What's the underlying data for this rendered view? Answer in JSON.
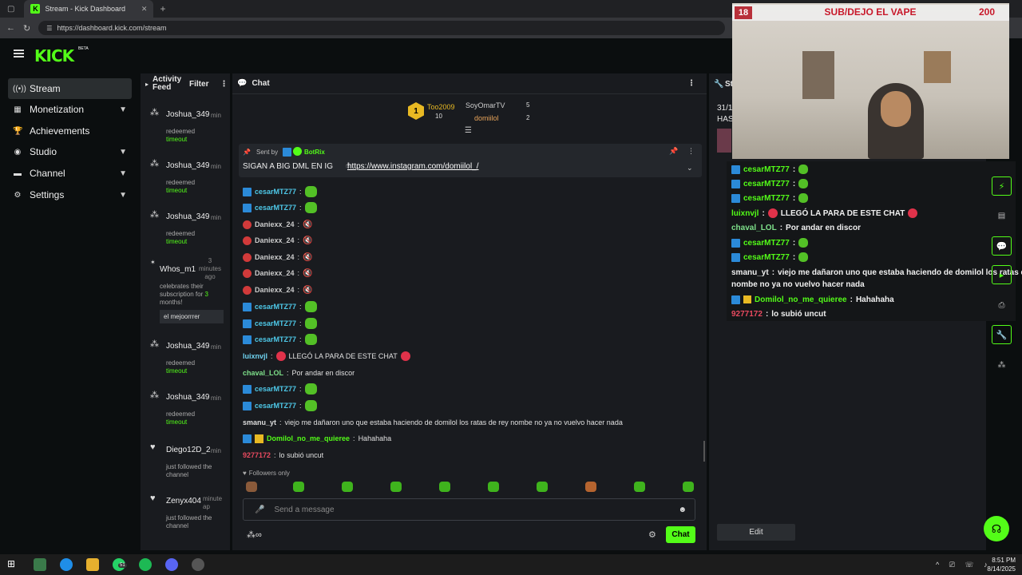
{
  "browser": {
    "tab_title": "Stream - Kick Dashboard",
    "url": "https://dashboard.kick.com/stream"
  },
  "brand": {
    "logo": "KICK",
    "beta": "BETA"
  },
  "sidebar": {
    "items": [
      {
        "label": "Stream",
        "icon": "broadcast-icon"
      },
      {
        "label": "Monetization",
        "icon": "dollar-icon"
      },
      {
        "label": "Achievements",
        "icon": "trophy-icon"
      },
      {
        "label": "Studio",
        "icon": "studio-icon"
      },
      {
        "label": "Channel",
        "icon": "channel-icon"
      },
      {
        "label": "Settings",
        "icon": "gear-icon"
      }
    ]
  },
  "activity": {
    "title": "Activity Feed",
    "filter": "Filter",
    "items": [
      {
        "user": "Joshua_349",
        "time": "min",
        "line1": "redeemed",
        "line2": "timeout"
      },
      {
        "user": "Joshua_349",
        "time": "min",
        "line1": "redeemed",
        "line2": "timeout"
      },
      {
        "user": "Joshua_349",
        "time": "min",
        "line1": "redeemed",
        "line2": "timeout"
      },
      {
        "user": "Whos_m1",
        "time": "3 minutes ago",
        "line1": "celebrates their subscription for",
        "months": "3",
        "line2": "months!",
        "message": "el mejoorrrer"
      },
      {
        "user": "Joshua_349",
        "time": "min",
        "line1": "redeemed",
        "line2": "timeout"
      },
      {
        "user": "Joshua_349",
        "time": "min",
        "line1": "redeemed",
        "line2": "timeout"
      },
      {
        "user": "Diego12D_2",
        "time": "min",
        "line1": "just followed the",
        "line2": "channel"
      },
      {
        "user": "Zenyx404",
        "time": "minute ap",
        "line1": "just followed the",
        "line2": "channel"
      }
    ]
  },
  "chat": {
    "title": "Chat",
    "leaderboard": [
      {
        "name": "Too2009",
        "count": "10"
      },
      {
        "name": "SoyOmarTV",
        "count": "5"
      },
      {
        "name": "domiilol",
        "count": "2"
      }
    ],
    "pinned": {
      "sent_by": "Sent by",
      "bot": "BotRix",
      "text": "SIGAN A BIG DML EN IG",
      "link": "https://www.instagram.com/domiilol_/"
    },
    "messages": [
      {
        "user": "cesarMTZ77",
        "text": ""
      },
      {
        "user": "cesarMTZ77",
        "text": ""
      },
      {
        "user": "Daniexx_24",
        "text": ""
      },
      {
        "user": "Daniexx_24",
        "text": ""
      },
      {
        "user": "Daniexx_24",
        "text": ""
      },
      {
        "user": "Daniexx_24",
        "text": ""
      },
      {
        "user": "Daniexx_24",
        "text": ""
      },
      {
        "user": "cesarMTZ77",
        "text": ""
      },
      {
        "user": "cesarMTZ77",
        "text": ""
      },
      {
        "user": "cesarMTZ77",
        "text": ""
      },
      {
        "user": "luixnvjl",
        "text": "LLEGÓ LA PARA DE ESTE CHAT"
      },
      {
        "user": "chaval_LOL",
        "text": "Por andar en discor"
      },
      {
        "user": "cesarMTZ77",
        "text": ""
      },
      {
        "user": "cesarMTZ77",
        "text": ""
      },
      {
        "user": "smanu_yt",
        "text": "viejo me dañaron uno que estaba haciendo de domilol los ratas de rey nombe no ya no vuelvo hacer nada"
      },
      {
        "user": "Domilol_no_me_quieree",
        "text": "Hahahaha"
      },
      {
        "user": "9277172",
        "text": "lo subió uncut"
      }
    ],
    "followers_only": "Followers only",
    "input_placeholder": "Send a message",
    "send_button": "Chat"
  },
  "right_panel": {
    "title": "St",
    "date_fragment": "31/1",
    "has_fragment": "HAS",
    "edit_button": "Edit",
    "messages": [
      {
        "user": "cesarMTZ77",
        "text": ""
      },
      {
        "user": "cesarMTZ77",
        "text": ""
      },
      {
        "user": "cesarMTZ77",
        "text": ""
      },
      {
        "user": "luixnvjl",
        "text": "LLEGÓ LA PARA DE ESTE CHAT"
      },
      {
        "user": "chaval_LOL",
        "text": "Por andar en discor"
      },
      {
        "user": "cesarMTZ77",
        "text": ""
      },
      {
        "user": "cesarMTZ77",
        "text": ""
      },
      {
        "user": "smanu_yt",
        "text": "viejo me dañaron uno que estaba haciendo de domilol los ratas d"
      },
      {
        "user": "",
        "text": "nombe no ya no vuelvo hacer nada"
      },
      {
        "user": "Domilol_no_me_quieree",
        "text": "Hahahaha"
      },
      {
        "user": "9277172",
        "text": "lo subió uncut"
      }
    ]
  },
  "webcam": {
    "left_counter": "18",
    "title": "SUB/DEJO EL VAPE",
    "right_counter": "200"
  },
  "taskbar": {
    "time": "8:51 PM",
    "date": "8/14/2025",
    "badge": "51"
  },
  "colors": {
    "accent": "#53fc18",
    "bg": "#0b0e0f",
    "panel": "#191b1f"
  }
}
